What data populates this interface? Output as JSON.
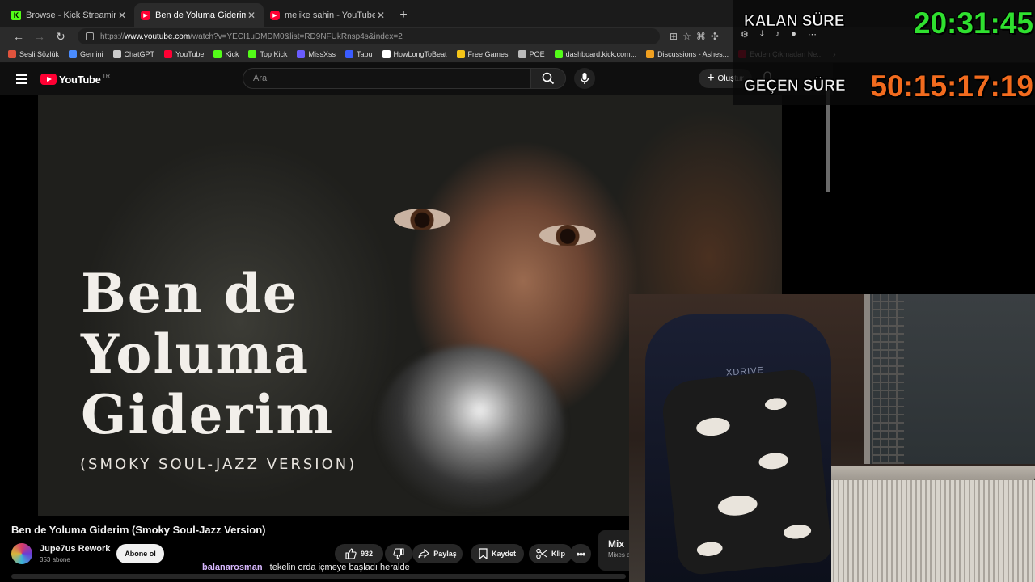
{
  "browser": {
    "tabs": [
      {
        "label": "Browse - Kick Streaming",
        "icon": "kick-icon",
        "active": false
      },
      {
        "label": "Ben de Yoluma Giderim (Smoky S",
        "icon": "youtube-icon",
        "active": true
      },
      {
        "label": "melike sahin - YouTube",
        "icon": "youtube-icon",
        "active": false
      }
    ],
    "new_tab": "+",
    "url_prefix": "https://",
    "url_host": "www.youtube.com",
    "url_path": "/watch?v=YECI1uDMDM0&list=RD9NFUkRnsp4s&index=2",
    "bookmarks": [
      {
        "label": "Sesli Sözlük",
        "icon": "sozluk-icon",
        "color": "#e0533d"
      },
      {
        "label": "Gemini",
        "icon": "gemini-icon",
        "color": "#4a8cff"
      },
      {
        "label": "ChatGPT",
        "icon": "chatgpt-icon",
        "color": "#cccccc"
      },
      {
        "label": "YouTube",
        "icon": "youtube-icon",
        "color": "#ff0033"
      },
      {
        "label": "Kick",
        "icon": "kick-icon",
        "color": "#53fc18"
      },
      {
        "label": "Top Kick",
        "icon": "kick-icon",
        "color": "#53fc18"
      },
      {
        "label": "MissXss",
        "icon": "missxss-icon",
        "color": "#6a5cff"
      },
      {
        "label": "Tabu",
        "icon": "tabu-icon",
        "color": "#3a5cff"
      },
      {
        "label": "HowLongToBeat",
        "icon": "hltb-icon",
        "color": "#ffffff"
      },
      {
        "label": "Free Games",
        "icon": "free-games-icon",
        "color": "#f5c518"
      },
      {
        "label": "POE",
        "icon": "folder-icon",
        "color": "#bbbbbb"
      },
      {
        "label": "dashboard.kick.com...",
        "icon": "kick-icon",
        "color": "#53fc18"
      },
      {
        "label": "Discussions - Ashes...",
        "icon": "steam-icon",
        "color": "#f0a020"
      },
      {
        "label": "Evden Çıkmadan Ne...",
        "icon": "youtube-icon",
        "color": "#ff0033"
      }
    ]
  },
  "youtube": {
    "logo_text": "YouTube",
    "region": "TR",
    "search_placeholder": "Ara",
    "create_label": "Oluştur",
    "thumbnail": {
      "title_lines": [
        "Ben de",
        "Yoluma",
        "Giderim"
      ],
      "subtitle": "(SMOKY SOUL-JAZZ VERSION)"
    },
    "video_title": "Ben de Yoluma Giderim (Smoky Soul-Jazz Version)",
    "channel_name": "Jupe7us Rework",
    "subscribers": "353 abone",
    "subscribe_label": "Abone ol",
    "like_count": "932",
    "share_label": "Paylaş",
    "save_label": "Kaydet",
    "clip_label": "Klip",
    "mix_title": "Mix",
    "mix_sub": "Mixes a"
  },
  "overlay": {
    "remaining_label": "KALAN SÜRE",
    "remaining_value": "20:31:45",
    "elapsed_label": "GEÇEN SÜRE",
    "elapsed_value": "50:15:17:19",
    "colors": {
      "remaining": "#2fe02f",
      "elapsed": "#f26b1e"
    }
  },
  "chat": {
    "username": "balanarosman",
    "message": "tekelin orda içmeye başladı heralde"
  },
  "webcam": {
    "chair_brand": "XDRIVE"
  }
}
